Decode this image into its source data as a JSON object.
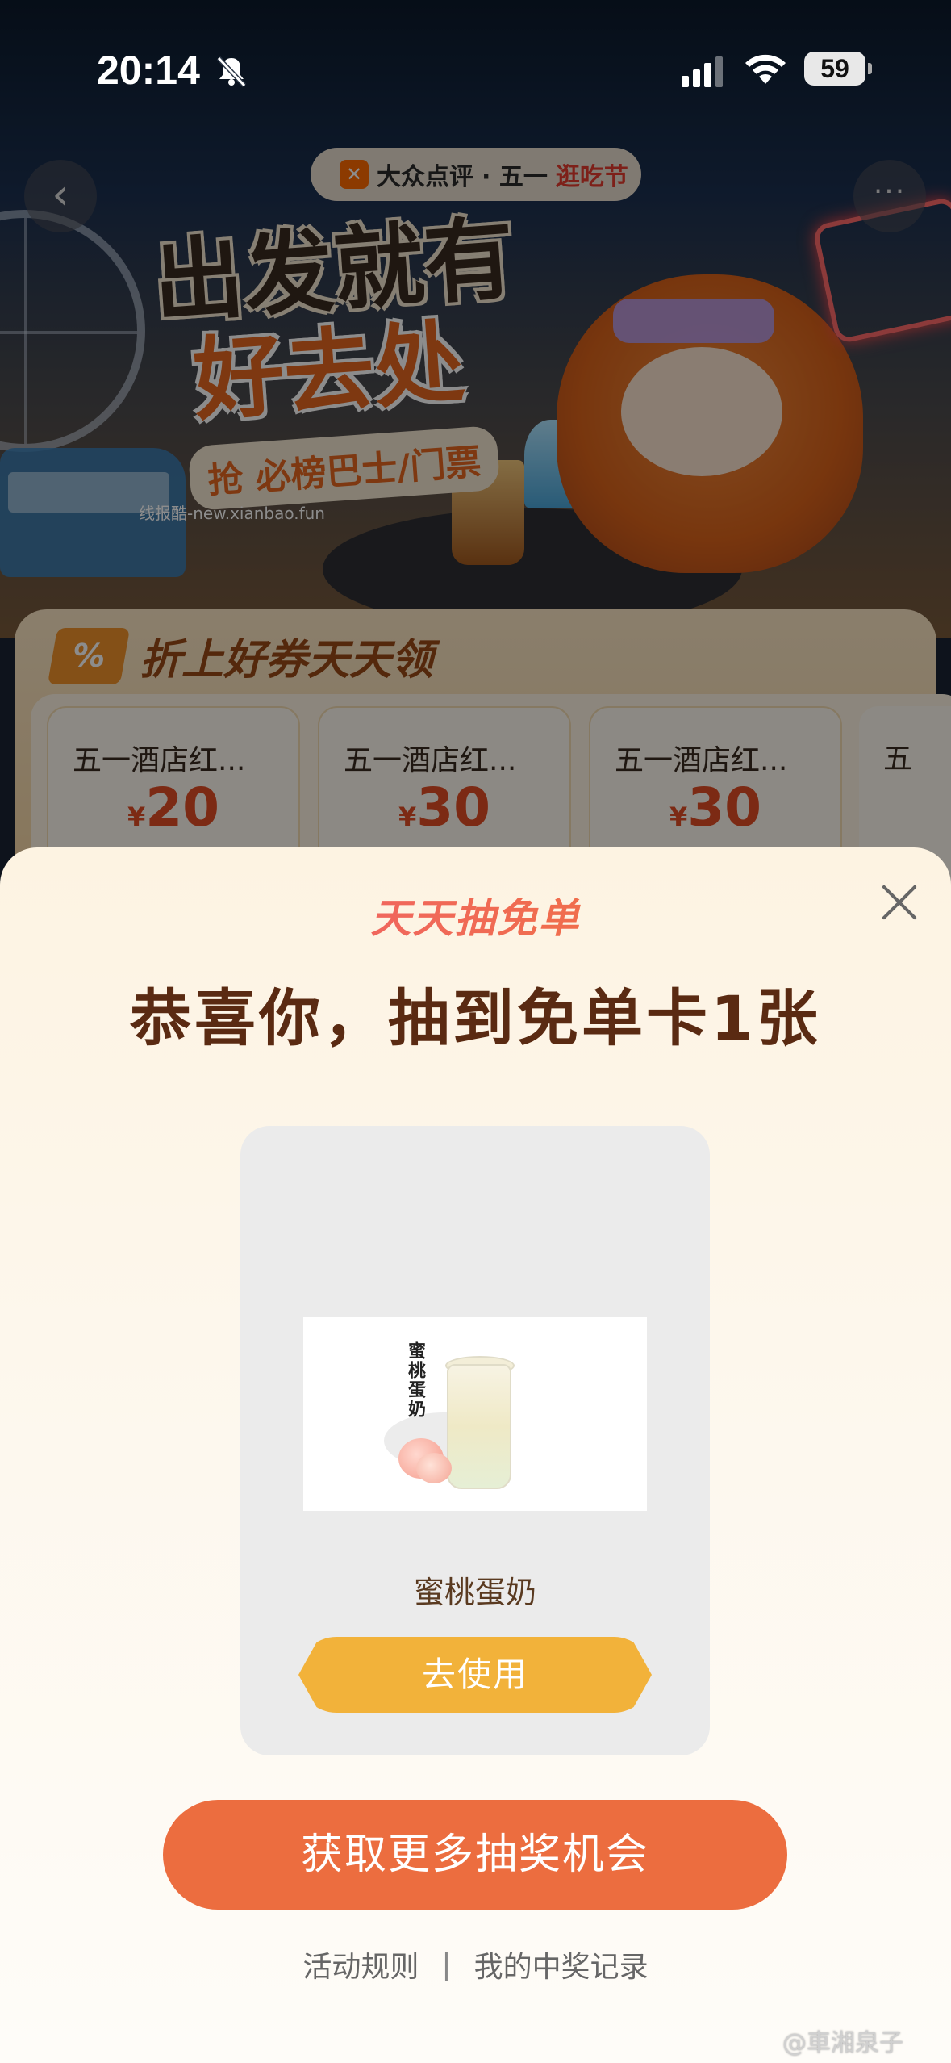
{
  "status_bar": {
    "time": "20:14",
    "battery": "59"
  },
  "background_page": {
    "brand_name": "大众点评",
    "brand_event": "· 五一",
    "brand_fest": "逛吃节",
    "hero_title_line1": "出发就有",
    "hero_title_line2": "好去处",
    "hero_subtitle": "抢 必榜巴士/门票",
    "watermark": "线报酷-new.xianbao.fun",
    "coupon_heading": "折上好券天天领",
    "coupon_badge": "%",
    "coupons": [
      {
        "title": "五一酒店红...",
        "currency": "¥",
        "amount": "20"
      },
      {
        "title": "五一酒店红...",
        "currency": "¥",
        "amount": "30"
      },
      {
        "title": "五一酒店红...",
        "currency": "¥",
        "amount": "30"
      },
      {
        "title": "五"
      }
    ]
  },
  "modal": {
    "brand_title": "天天抽免单",
    "congrats_text": "恭喜你，抽到免单卡1张",
    "prize": {
      "image_label": "蜜桃蛋奶",
      "name": "蜜桃蛋奶",
      "use_button": "去使用"
    },
    "more_chances_button": "获取更多抽奖机会",
    "footer": {
      "rules_link": "活动规则",
      "separator": "|",
      "records_link": "我的中奖记录"
    }
  },
  "weibo_watermark": "@車湘泉子",
  "colors": {
    "accent_orange": "#ec6d3f",
    "use_button_yellow": "#f2b23a",
    "congrats_brown": "#5a2a12"
  }
}
